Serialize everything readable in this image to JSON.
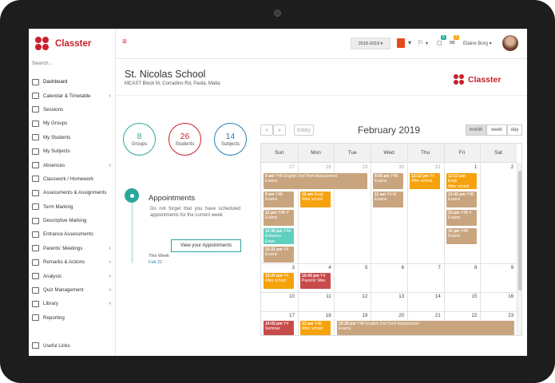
{
  "app": {
    "name": "Classter"
  },
  "sidebar": {
    "search": "Search...",
    "items": [
      {
        "label": "Dashboard",
        "arrow": false
      },
      {
        "label": "Calendar & Timetable",
        "arrow": true
      },
      {
        "label": "Sessions",
        "arrow": false
      },
      {
        "label": "My Groups",
        "arrow": false
      },
      {
        "label": "My Students",
        "arrow": false
      },
      {
        "label": "My Subjects",
        "arrow": false
      },
      {
        "label": "Absences",
        "arrow": true
      },
      {
        "label": "Classwork / Homework",
        "arrow": false
      },
      {
        "label": "Assessments & Assignments",
        "arrow": false
      },
      {
        "label": "Term Marking",
        "arrow": false
      },
      {
        "label": "Descriptive Marking",
        "arrow": false
      },
      {
        "label": "Entrance Assessments",
        "arrow": false
      },
      {
        "label": "Parents' Meetings",
        "arrow": true
      },
      {
        "label": "Remarks & Actions",
        "arrow": true
      },
      {
        "label": "Analysis",
        "arrow": true
      },
      {
        "label": "Quiz Management",
        "arrow": true
      },
      {
        "label": "Library",
        "arrow": true
      },
      {
        "label": "Reporting",
        "arrow": false
      }
    ],
    "useful_links": "Useful Links"
  },
  "topbar": {
    "menu_icon": "≡",
    "year": "2018-2019 ▾",
    "flag_badge": "",
    "notif_badge": "6",
    "msg_badge": "2",
    "user_name": "Elaine Borg ▾"
  },
  "school": {
    "name": "St. Nicolas School",
    "address": "MCAST Block M, Corradino Rd, Paola, Malta"
  },
  "stats": [
    {
      "value": "8",
      "label": "Groups",
      "color": "#2aa79b"
    },
    {
      "value": "26",
      "label": "Students",
      "color": "#c9202a"
    },
    {
      "value": "14",
      "label": "Subjects",
      "color": "#2a7fb8"
    }
  ],
  "appointments": {
    "title": "Appointments",
    "text": "Do not forget that you have scheduled appointments for the current week",
    "button": "View your Appointments",
    "week_label": "This Week",
    "week_value": "Feb 22"
  },
  "calendar": {
    "prev": "‹",
    "next": "›",
    "today": "today",
    "title": "February 2019",
    "views": [
      "month",
      "week",
      "day"
    ],
    "days": [
      "Sun",
      "Mon",
      "Tue",
      "Wed",
      "Thu",
      "Fri",
      "Sat"
    ],
    "weeks": [
      [
        "27",
        "28",
        "29",
        "30",
        "31",
        "1",
        "2"
      ],
      [
        "3",
        "4",
        "5",
        "6",
        "7",
        "8",
        "9"
      ],
      [
        "10",
        "11",
        "12",
        "13",
        "14",
        "15",
        "16"
      ],
      [
        "17",
        "18",
        "19",
        "20",
        "21",
        "22",
        "23"
      ]
    ],
    "events": [
      {
        "time": "9 am",
        "title": "Y4B English 2nd Term Assessment",
        "sub": "Exams"
      },
      {
        "time": "9 am",
        "title": "Y4B",
        "sub": "Exams"
      },
      {
        "time": "12 pm",
        "title": "Y4B P",
        "sub": "Exams"
      },
      {
        "time": "12:30 pm",
        "title": "Y4A",
        "sub": "Entrance Exam"
      },
      {
        "time": "10:31 pm",
        "title": "Y4",
        "sub": "Exams"
      },
      {
        "time": "10 am",
        "title": "Engli",
        "sub": "After school"
      },
      {
        "time": "9:05 am",
        "title": "Y4B",
        "sub": "Exams"
      },
      {
        "time": "11 am",
        "title": "Y4 M",
        "sub": "Exams"
      },
      {
        "time": "12:12 pm",
        "title": "Y4",
        "sub": "After school"
      },
      {
        "time": "12:12 pm",
        "title": "Engli",
        "sub": "After school"
      },
      {
        "time": "12:42 pm",
        "title": "Y4B",
        "sub": "Exams"
      },
      {
        "time": "12 pm",
        "title": "Y4B F",
        "sub": "Exams"
      },
      {
        "time": "10 pm",
        "title": "Y4B",
        "sub": "Exams"
      },
      {
        "time": "12:47 pm",
        "title": "Y4",
        "sub": "After school"
      },
      {
        "time": "10:43 pm",
        "title": "Y4",
        "sub": "Parents' Mee"
      },
      {
        "time": "14:03 pm",
        "title": "Y4",
        "sub": "Seminar"
      },
      {
        "time": "12 pm",
        "title": "Y4B",
        "sub": "After school"
      },
      {
        "time": "10:28 pm",
        "title": "Y4B English 2nd Term Assessment",
        "sub": "Exams"
      }
    ]
  },
  "colors": {
    "brand": "#c9202a",
    "accent": "#2aa79b",
    "event_tan": "#c9a57f",
    "event_orange": "#f5a20c",
    "event_red": "#c84b4b",
    "event_teal": "#5fcfbf"
  }
}
